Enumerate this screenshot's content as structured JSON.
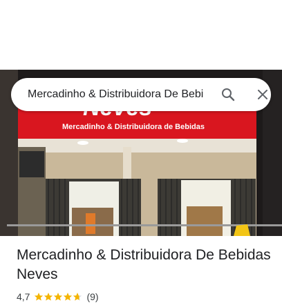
{
  "search": {
    "value": "Mercadinho & Distribuidora De Bebi"
  },
  "photo": {
    "sign_partial": "Neves",
    "sign_subtitle": "Mercadinho & Distribuidora de Bebidas",
    "sign_color": "#d9161f"
  },
  "place": {
    "title": "Mercadinho & Distribuidora De Bebidas Neves",
    "rating": "4,7",
    "stars": 4.7,
    "review_count": "(9)"
  },
  "colors": {
    "star": "#f4b400",
    "text": "#202124"
  }
}
